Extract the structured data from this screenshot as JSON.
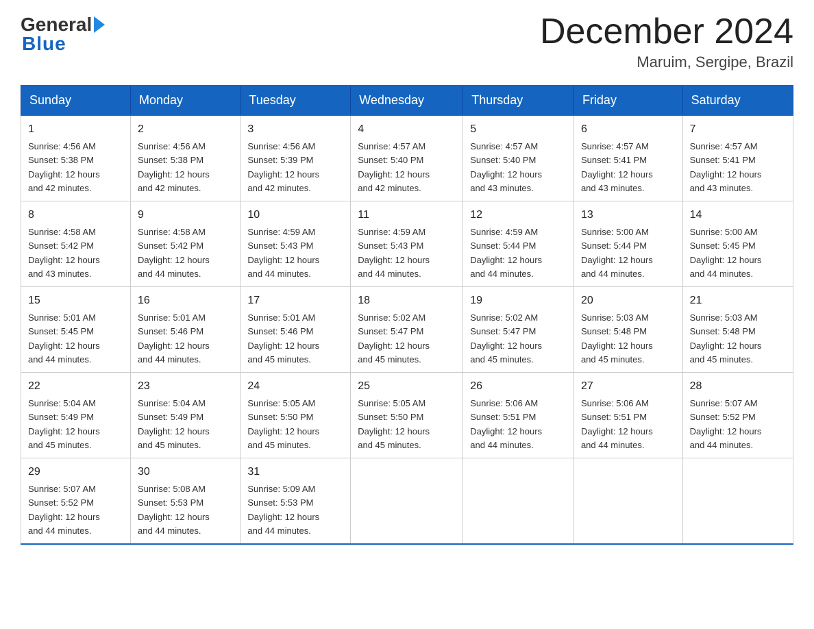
{
  "logo": {
    "general": "General",
    "blue": "Blue"
  },
  "title": {
    "month_year": "December 2024",
    "location": "Maruim, Sergipe, Brazil"
  },
  "days_of_week": [
    "Sunday",
    "Monday",
    "Tuesday",
    "Wednesday",
    "Thursday",
    "Friday",
    "Saturday"
  ],
  "weeks": [
    [
      {
        "day": "1",
        "sunrise": "4:56 AM",
        "sunset": "5:38 PM",
        "daylight": "12 hours and 42 minutes."
      },
      {
        "day": "2",
        "sunrise": "4:56 AM",
        "sunset": "5:38 PM",
        "daylight": "12 hours and 42 minutes."
      },
      {
        "day": "3",
        "sunrise": "4:56 AM",
        "sunset": "5:39 PM",
        "daylight": "12 hours and 42 minutes."
      },
      {
        "day": "4",
        "sunrise": "4:57 AM",
        "sunset": "5:40 PM",
        "daylight": "12 hours and 42 minutes."
      },
      {
        "day": "5",
        "sunrise": "4:57 AM",
        "sunset": "5:40 PM",
        "daylight": "12 hours and 43 minutes."
      },
      {
        "day": "6",
        "sunrise": "4:57 AM",
        "sunset": "5:41 PM",
        "daylight": "12 hours and 43 minutes."
      },
      {
        "day": "7",
        "sunrise": "4:57 AM",
        "sunset": "5:41 PM",
        "daylight": "12 hours and 43 minutes."
      }
    ],
    [
      {
        "day": "8",
        "sunrise": "4:58 AM",
        "sunset": "5:42 PM",
        "daylight": "12 hours and 43 minutes."
      },
      {
        "day": "9",
        "sunrise": "4:58 AM",
        "sunset": "5:42 PM",
        "daylight": "12 hours and 44 minutes."
      },
      {
        "day": "10",
        "sunrise": "4:59 AM",
        "sunset": "5:43 PM",
        "daylight": "12 hours and 44 minutes."
      },
      {
        "day": "11",
        "sunrise": "4:59 AM",
        "sunset": "5:43 PM",
        "daylight": "12 hours and 44 minutes."
      },
      {
        "day": "12",
        "sunrise": "4:59 AM",
        "sunset": "5:44 PM",
        "daylight": "12 hours and 44 minutes."
      },
      {
        "day": "13",
        "sunrise": "5:00 AM",
        "sunset": "5:44 PM",
        "daylight": "12 hours and 44 minutes."
      },
      {
        "day": "14",
        "sunrise": "5:00 AM",
        "sunset": "5:45 PM",
        "daylight": "12 hours and 44 minutes."
      }
    ],
    [
      {
        "day": "15",
        "sunrise": "5:01 AM",
        "sunset": "5:45 PM",
        "daylight": "12 hours and 44 minutes."
      },
      {
        "day": "16",
        "sunrise": "5:01 AM",
        "sunset": "5:46 PM",
        "daylight": "12 hours and 44 minutes."
      },
      {
        "day": "17",
        "sunrise": "5:01 AM",
        "sunset": "5:46 PM",
        "daylight": "12 hours and 45 minutes."
      },
      {
        "day": "18",
        "sunrise": "5:02 AM",
        "sunset": "5:47 PM",
        "daylight": "12 hours and 45 minutes."
      },
      {
        "day": "19",
        "sunrise": "5:02 AM",
        "sunset": "5:47 PM",
        "daylight": "12 hours and 45 minutes."
      },
      {
        "day": "20",
        "sunrise": "5:03 AM",
        "sunset": "5:48 PM",
        "daylight": "12 hours and 45 minutes."
      },
      {
        "day": "21",
        "sunrise": "5:03 AM",
        "sunset": "5:48 PM",
        "daylight": "12 hours and 45 minutes."
      }
    ],
    [
      {
        "day": "22",
        "sunrise": "5:04 AM",
        "sunset": "5:49 PM",
        "daylight": "12 hours and 45 minutes."
      },
      {
        "day": "23",
        "sunrise": "5:04 AM",
        "sunset": "5:49 PM",
        "daylight": "12 hours and 45 minutes."
      },
      {
        "day": "24",
        "sunrise": "5:05 AM",
        "sunset": "5:50 PM",
        "daylight": "12 hours and 45 minutes."
      },
      {
        "day": "25",
        "sunrise": "5:05 AM",
        "sunset": "5:50 PM",
        "daylight": "12 hours and 45 minutes."
      },
      {
        "day": "26",
        "sunrise": "5:06 AM",
        "sunset": "5:51 PM",
        "daylight": "12 hours and 44 minutes."
      },
      {
        "day": "27",
        "sunrise": "5:06 AM",
        "sunset": "5:51 PM",
        "daylight": "12 hours and 44 minutes."
      },
      {
        "day": "28",
        "sunrise": "5:07 AM",
        "sunset": "5:52 PM",
        "daylight": "12 hours and 44 minutes."
      }
    ],
    [
      {
        "day": "29",
        "sunrise": "5:07 AM",
        "sunset": "5:52 PM",
        "daylight": "12 hours and 44 minutes."
      },
      {
        "day": "30",
        "sunrise": "5:08 AM",
        "sunset": "5:53 PM",
        "daylight": "12 hours and 44 minutes."
      },
      {
        "day": "31",
        "sunrise": "5:09 AM",
        "sunset": "5:53 PM",
        "daylight": "12 hours and 44 minutes."
      },
      null,
      null,
      null,
      null
    ]
  ],
  "labels": {
    "sunrise": "Sunrise:",
    "sunset": "Sunset:",
    "daylight": "Daylight:"
  }
}
